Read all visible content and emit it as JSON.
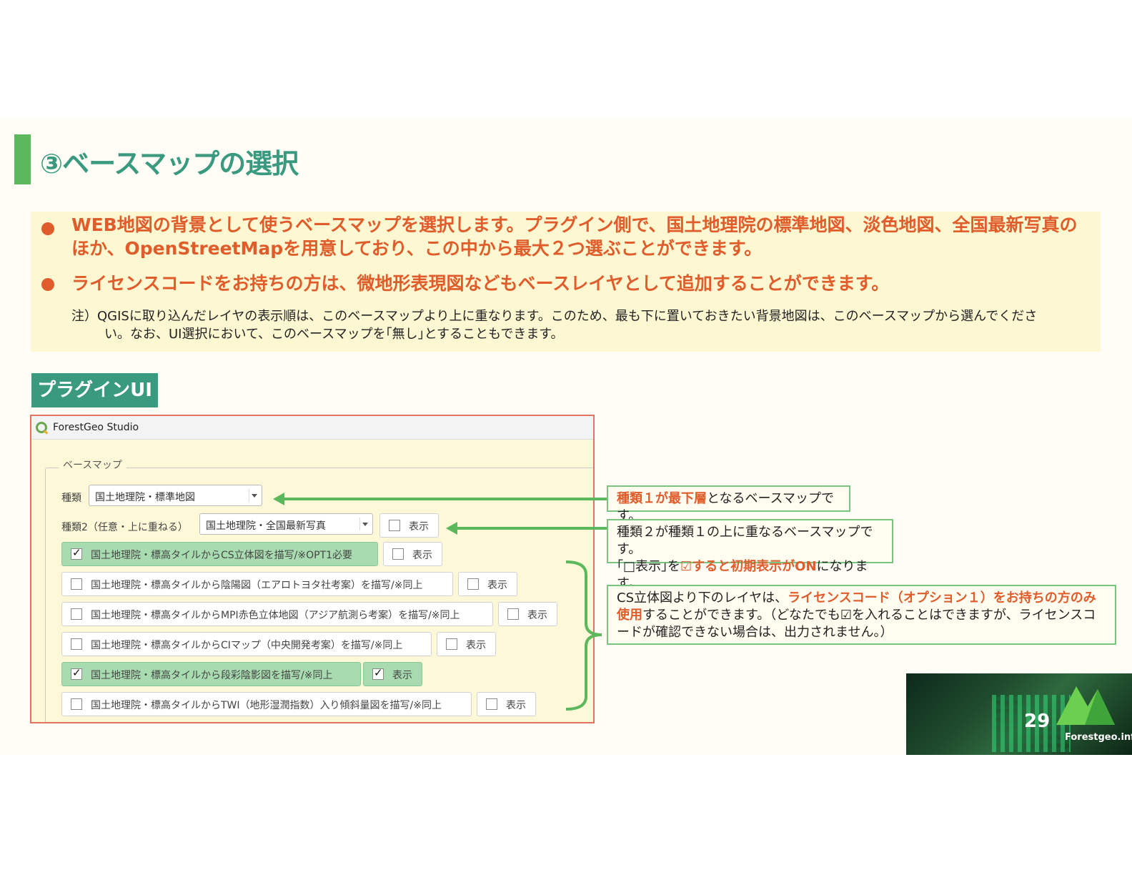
{
  "slide": {
    "title": "③ベースマップの選択",
    "bullets": [
      "WEB地図の背景として使うベースマップを選択します。プラグイン側で、国土地理院の標準地図、淡色地図、全国最新写真のほか、OpenStreetMapを用意しており、この中から最大２つ選ぶことができます。",
      "ライセンスコードをお持ちの方は、微地形表現図などもベースレイヤとして追加することができます。"
    ],
    "note_line1": "注）QGISに取り込んだレイヤの表示順は、このベースマップより上に重なります。このため、最も下に置いておきたい背景地図は、このベースマップから選んでくださ",
    "note_line2": "い。なお、UI選択において、このベースマップを｢無し｣とすることもできます。",
    "plugin_tag": "プラグインUI",
    "page_number": "29",
    "brand": "Forestgeo.info"
  },
  "window": {
    "title": "ForestGeo Studio",
    "group_label": "ベースマップ",
    "type1_label": "種類",
    "type1_value": "国土地理院・標準地図",
    "type2_label": "種類2（任意・上に重ねる）",
    "type2_value": "国土地理院・全国最新写真",
    "type2_show_label": "表示",
    "options": [
      {
        "label": "国土地理院・標高タイルからCS立体図を描写/※OPT1必要",
        "checked": true,
        "show_label": "表示",
        "show_checked": false
      },
      {
        "label": "国土地理院・標高タイルから陰陽図（エアロトヨタ社考案）を描写/※同上",
        "checked": false,
        "show_label": "表示",
        "show_checked": false
      },
      {
        "label": "国土地理院・標高タイルからMPI赤色立体地図（アジア航測ら考案）を描写/※同上",
        "checked": false,
        "show_label": "表示",
        "show_checked": false
      },
      {
        "label": "国土地理院・標高タイルからCIマップ（中央開発考案）を描写/※同上",
        "checked": false,
        "show_label": "表示",
        "show_checked": false
      },
      {
        "label": "国土地理院・標高タイルから段彩陰影図を描写/※同上",
        "checked": true,
        "show_label": "表示",
        "show_checked": true
      },
      {
        "label": "国土地理院・標高タイルからTWI（地形湿潤指数）入り傾斜量図を描写/※同上",
        "checked": false,
        "show_label": "表示",
        "show_checked": false
      }
    ]
  },
  "callouts": {
    "c1_highlight": "種類１が最下層",
    "c1_rest": "となるベースマップです。",
    "c2_line1": "種類２が種類１の上に重なるベースマップです。",
    "c2_pre": "｢□表示｣を",
    "c2_highlight": "☑すると初期表示がON",
    "c2_post": "になります。",
    "c3_pre": "CS立体図より下のレイヤは、",
    "c3_highlight": "ライセンスコード（オプション１）をお持ちの方のみ使用",
    "c3_post": "することができます。（どなたでも☑を入れることはできますが、ライセンスコードが確認できない場合は、出力されません。）"
  },
  "colors": {
    "accent_green": "#3a9a7f",
    "bar_green": "#5cb85c",
    "orange": "#e05c2a",
    "highlight_bg": "#fdf7d2"
  }
}
